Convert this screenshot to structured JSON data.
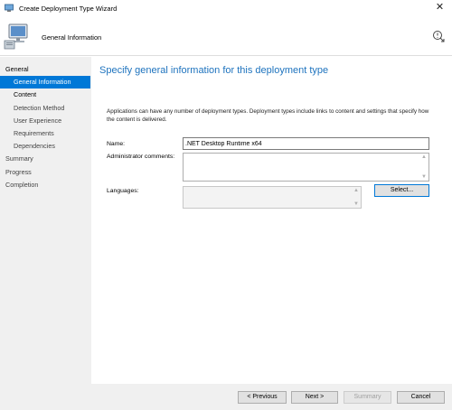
{
  "window": {
    "title": "Create Deployment Type Wizard",
    "close_glyph": "✕"
  },
  "banner": {
    "title": "General Information",
    "icon": "computer-icon",
    "help_icon": "help-icon"
  },
  "sidebar": {
    "items": [
      {
        "label": "General",
        "level": 0,
        "active": false,
        "bold": true
      },
      {
        "label": "General Information",
        "level": 1,
        "active": true,
        "bold": false
      },
      {
        "label": "Content",
        "level": 1,
        "active": false,
        "bold": true
      },
      {
        "label": "Detection Method",
        "level": 1,
        "active": false,
        "bold": false
      },
      {
        "label": "User Experience",
        "level": 1,
        "active": false,
        "bold": false
      },
      {
        "label": "Requirements",
        "level": 1,
        "active": false,
        "bold": false
      },
      {
        "label": "Dependencies",
        "level": 1,
        "active": false,
        "bold": false
      },
      {
        "label": "Summary",
        "level": 0,
        "active": false,
        "bold": false
      },
      {
        "label": "Progress",
        "level": 0,
        "active": false,
        "bold": false
      },
      {
        "label": "Completion",
        "level": 0,
        "active": false,
        "bold": false
      }
    ]
  },
  "main": {
    "heading": "Specify general information for this deployment type",
    "description": "Applications can have any number of deployment types. Deployment types include links to content and settings that specify how the content is delivered.",
    "name_label": "Name:",
    "name_value": ".NET Desktop Runtime x64",
    "admin_comments_label": "Administrator comments:",
    "admin_comments_value": "",
    "languages_label": "Languages:",
    "select_button": "Select..."
  },
  "footer": {
    "previous": "< Previous",
    "next": "Next >",
    "summary": "Summary",
    "cancel": "Cancel"
  },
  "colors": {
    "accent": "#0078d7",
    "heading": "#1e73be",
    "sidebar_bg": "#f0f0f0"
  }
}
